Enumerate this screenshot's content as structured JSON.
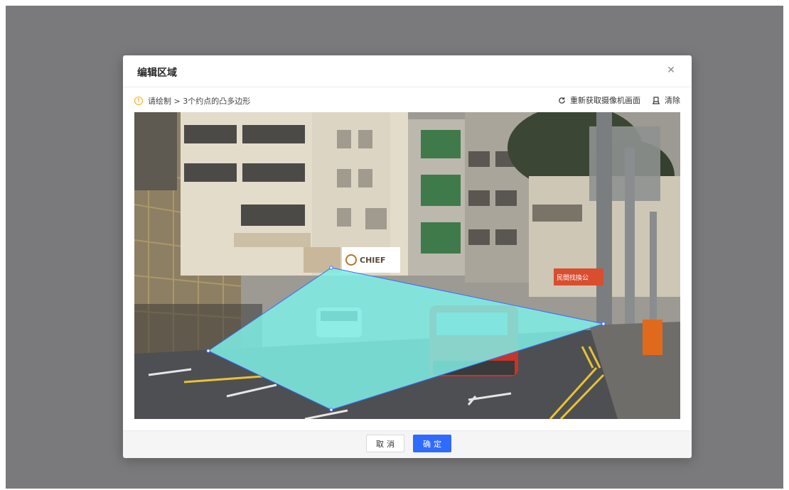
{
  "dialog": {
    "title": "编辑区域",
    "close_icon": "close-icon",
    "hint_text": "请绘制 > 3个约点的凸多边形",
    "actions": {
      "refresh_label": "重新获取摄像机画面",
      "clear_label": "清除"
    }
  },
  "canvas": {
    "sign_text": "CHIEF",
    "shop_sign_text": "民間找換公",
    "polygon_fill": "#7ff0e6",
    "polygon_stroke": "#3a6cff"
  },
  "footer": {
    "cancel_label": "取消",
    "ok_label": "确定"
  },
  "colors": {
    "overlay": "#7a7a7c",
    "primary": "#2f6bff",
    "warning": "#faad14"
  }
}
